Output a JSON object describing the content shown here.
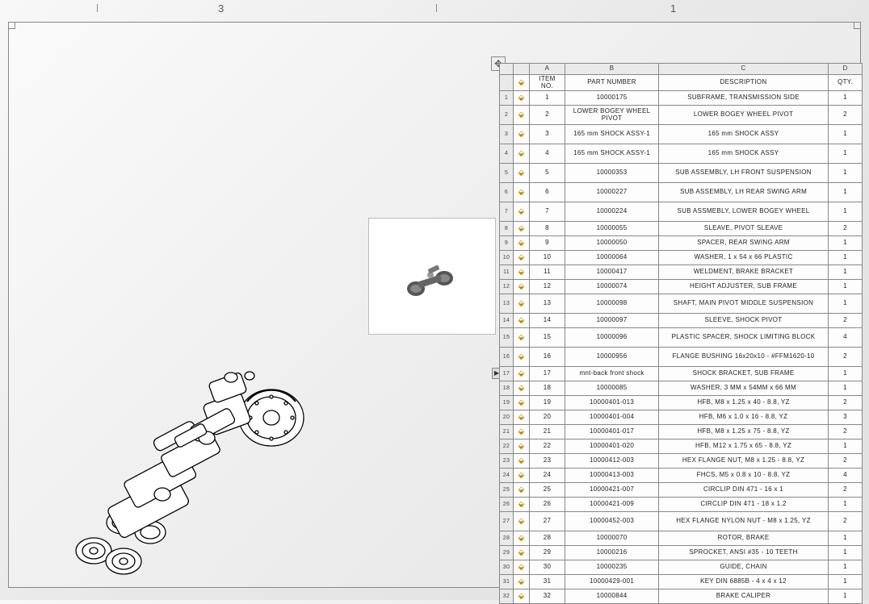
{
  "zones": {
    "left": "3",
    "right": "1"
  },
  "column_letters": [
    "A",
    "B",
    "C",
    "D"
  ],
  "header_row": [
    "ITEM NO.",
    "PART NUMBER",
    "DESCRIPTION",
    "QTY."
  ],
  "rows": [
    {
      "n": "1",
      "item": "1",
      "part": "10000175",
      "desc": "SUBFRAME, TRANSMISSION SIDE",
      "qty": "1",
      "tall": false
    },
    {
      "n": "2",
      "item": "2",
      "part": "LOWER BOGEY WHEEL PIVOT",
      "desc": "LOWER BOGEY WHEEL PIVOT",
      "qty": "2",
      "tall": true
    },
    {
      "n": "3",
      "item": "3",
      "part": "165 mm SHOCK ASSY-1",
      "desc": "165 mm SHOCK ASSY",
      "qty": "1",
      "tall": true
    },
    {
      "n": "4",
      "item": "4",
      "part": "165 mm SHOCK ASSY-1",
      "desc": "165 mm SHOCK ASSY",
      "qty": "1",
      "tall": true
    },
    {
      "n": "5",
      "item": "5",
      "part": "10000353",
      "desc": "SUB ASSEMBLY, LH FRONT SUSPENSION",
      "qty": "1",
      "tall": true
    },
    {
      "n": "6",
      "item": "6",
      "part": "10000227",
      "desc": "SUB ASSEMBLY, LH REAR SWING ARM",
      "qty": "1",
      "tall": true
    },
    {
      "n": "7",
      "item": "7",
      "part": "10000224",
      "desc": "SUB ASSMEBLY, LOWER BOGEY WHEEL",
      "qty": "1",
      "tall": true
    },
    {
      "n": "8",
      "item": "8",
      "part": "10000055",
      "desc": "SLEAVE, PIVOT SLEAVE",
      "qty": "2",
      "tall": false
    },
    {
      "n": "9",
      "item": "9",
      "part": "10000050",
      "desc": "SPACER, REAR SWING ARM",
      "qty": "1",
      "tall": false
    },
    {
      "n": "10",
      "item": "10",
      "part": "10000064",
      "desc": "WASHER, 1 x 54 x 66 PLASTIC",
      "qty": "1",
      "tall": false
    },
    {
      "n": "11",
      "item": "11",
      "part": "10000417",
      "desc": "WELDMENT, BRAKE BRACKET",
      "qty": "1",
      "tall": false
    },
    {
      "n": "12",
      "item": "12",
      "part": "10000074",
      "desc": "HEIGHT ADJUSTER, SUB FRAME",
      "qty": "1",
      "tall": false
    },
    {
      "n": "13",
      "item": "13",
      "part": "10000098",
      "desc": "SHAFT, MAIN PIVOT MIDDLE SUSPENSION",
      "qty": "1",
      "tall": true
    },
    {
      "n": "14",
      "item": "14",
      "part": "10000097",
      "desc": "SLEEVE, SHOCK PIVOT",
      "qty": "2",
      "tall": false
    },
    {
      "n": "15",
      "item": "15",
      "part": "10000096",
      "desc": "PLASTIC SPACER, SHOCK LIMITING BLOCK",
      "qty": "4",
      "tall": true
    },
    {
      "n": "16",
      "item": "16",
      "part": "10000956",
      "desc": "FLANGE BUSHING 16x20x10 - #FFM1620-10",
      "qty": "2",
      "tall": true
    },
    {
      "n": "17",
      "item": "17",
      "part": "mnt-back front shock",
      "desc": "SHOCK BRACKET, SUB FRAME",
      "qty": "1",
      "tall": false
    },
    {
      "n": "18",
      "item": "18",
      "part": "10000085",
      "desc": "WASHER, 3 MM x 54MM x 66 MM",
      "qty": "1",
      "tall": false
    },
    {
      "n": "19",
      "item": "19",
      "part": "10000401-013",
      "desc": "HFB, M8 x 1.25 x 40 - 8.8, YZ",
      "qty": "2",
      "tall": false
    },
    {
      "n": "20",
      "item": "20",
      "part": "10000401-004",
      "desc": "HFB, M6 x 1.0 x 16 - 8.8, YZ",
      "qty": "3",
      "tall": false
    },
    {
      "n": "21",
      "item": "21",
      "part": "10000401-017",
      "desc": "HFB, M8 x 1.25 x 75 - 8.8, YZ",
      "qty": "2",
      "tall": false
    },
    {
      "n": "22",
      "item": "22",
      "part": "10000401-020",
      "desc": "HFB, M12 x 1.75 x 65 - 8.8, YZ",
      "qty": "1",
      "tall": false
    },
    {
      "n": "23",
      "item": "23",
      "part": "10000412-003",
      "desc": "HEX FLANGE NUT, M8 x 1.25 - 8.8, YZ",
      "qty": "2",
      "tall": false
    },
    {
      "n": "24",
      "item": "24",
      "part": "10000413-003",
      "desc": "FHCS, M5 x 0.8 x 10 - 8.8, YZ",
      "qty": "4",
      "tall": false
    },
    {
      "n": "25",
      "item": "25",
      "part": "10000421-007",
      "desc": "CIRCLIP DIN 471 - 16 x 1",
      "qty": "2",
      "tall": false
    },
    {
      "n": "26",
      "item": "26",
      "part": "10000421-009",
      "desc": "CIRCLIP DIN 471 - 18 x 1.2",
      "qty": "1",
      "tall": false
    },
    {
      "n": "27",
      "item": "27",
      "part": "10000452-003",
      "desc": "HEX FLANGE NYLON NUT - M8 x 1.25, YZ",
      "qty": "2",
      "tall": true
    },
    {
      "n": "28",
      "item": "28",
      "part": "10000070",
      "desc": "ROTOR, BRAKE",
      "qty": "1",
      "tall": false
    },
    {
      "n": "29",
      "item": "29",
      "part": "10000216",
      "desc": "SPROCKET, ANSI #35 - 10 TEETH",
      "qty": "1",
      "tall": false
    },
    {
      "n": "30",
      "item": "30",
      "part": "10000235",
      "desc": "GUIDE, CHAIN",
      "qty": "1",
      "tall": false
    },
    {
      "n": "31",
      "item": "31",
      "part": "10000429-001",
      "desc": "KEY DIN 6885B - 4 x 4 x 12",
      "qty": "1",
      "tall": false
    },
    {
      "n": "32",
      "item": "32",
      "part": "10000844",
      "desc": "BRAKE CALIPER",
      "qty": "1",
      "tall": false
    }
  ]
}
